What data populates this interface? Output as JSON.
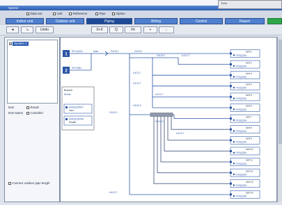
{
  "app": {
    "title": "Xpress",
    "mini_window_title": "Tutor"
  },
  "menu": [
    {
      "label": "Data set"
    },
    {
      "label": "Unit"
    },
    {
      "label": "Reference"
    },
    {
      "label": "Pipe"
    },
    {
      "label": "Option"
    }
  ],
  "tabs": [
    {
      "label": "Indoor unit"
    },
    {
      "label": "Outdoor unit"
    },
    {
      "label": "Piping",
      "active": true
    },
    {
      "label": "Wiring"
    },
    {
      "label": "Control"
    },
    {
      "label": "Report"
    },
    {
      "label": "",
      "color": "#2fa64a"
    }
  ],
  "toolbar": [
    {
      "icon": "arrow-left-icon",
      "text": "◄"
    },
    {
      "icon": "arrow-diagonal-icon",
      "text": "↘"
    },
    {
      "text": "Undo"
    },
    {
      "text": "X+X"
    },
    {
      "icon": "magnifier-icon",
      "text": "Q"
    },
    {
      "text": "Fit"
    },
    {
      "icon": "plus-icon",
      "text": "+"
    },
    {
      "icon": "arrow-down-icon",
      "text": "↓"
    }
  ],
  "tree": {
    "expander": "+",
    "root_label": "System 1"
  },
  "properties": [
    {
      "label": "Item",
      "option": "Result"
    },
    {
      "label": "Item Name",
      "option": "Controller"
    }
  ],
  "bottom_option": {
    "label": "Connect outdoor pipe length",
    "checked": false
  },
  "diagram": {
    "colors": {
      "pipe": "#2b56a6",
      "header": "#8f99ab",
      "cluster": "#5d6f92"
    },
    "outdoor_units": [
      {
        "number": "1",
        "model": "RXYQ10U"
      },
      {
        "number": "2",
        "model": "RXYQ8U"
      }
    ],
    "main_label": "Main",
    "legend": {
      "title": "Branch",
      "subtitle": "Refnet",
      "items": [
        {
          "line1": "KHRQ22M20T",
          "line2": "Joint"
        },
        {
          "line1": "KHRQ22M75H",
          "line2": "Header"
        }
      ]
    },
    "pipe_labels": [
      "9.5/19.1",
      "9.5/19.1",
      "9.5/15.9",
      "6.4/12.7",
      "6.4/12.7",
      "6.4/12.7",
      "6.4/12.7",
      "9.5/15.9",
      "9.5/19.1",
      "9.5/15.9",
      "6.4/12.7",
      "6.4/12.7"
    ],
    "indoor_units": [
      {
        "name": "Unit 1",
        "model": "FXSQ20A"
      },
      {
        "name": "Unit 2",
        "model": "FXSQ20A"
      },
      {
        "name": "Unit 3",
        "model": "FXSQ25A"
      },
      {
        "name": "Unit 4",
        "model": "FXSQ25A"
      },
      {
        "name": "Unit 5",
        "model": "FXSQ20A"
      },
      {
        "name": "Unit 6",
        "model": "FXSQ32A"
      },
      {
        "name": "Unit 7",
        "model": "FXSQ20A"
      },
      {
        "name": "Unit 8",
        "model": "FXSQ20A"
      },
      {
        "name": "Unit 9",
        "model": "FXSQ25A"
      },
      {
        "name": "Unit 10",
        "model": "FXSQ25A"
      },
      {
        "name": "Unit 11",
        "model": "FXSQ20A"
      },
      {
        "name": "Unit 12",
        "model": "FXSQ20A"
      },
      {
        "name": "Unit 13",
        "model": "FXSQ32A"
      },
      {
        "name": "Unit 14",
        "model": "FXSQ25A"
      }
    ]
  }
}
